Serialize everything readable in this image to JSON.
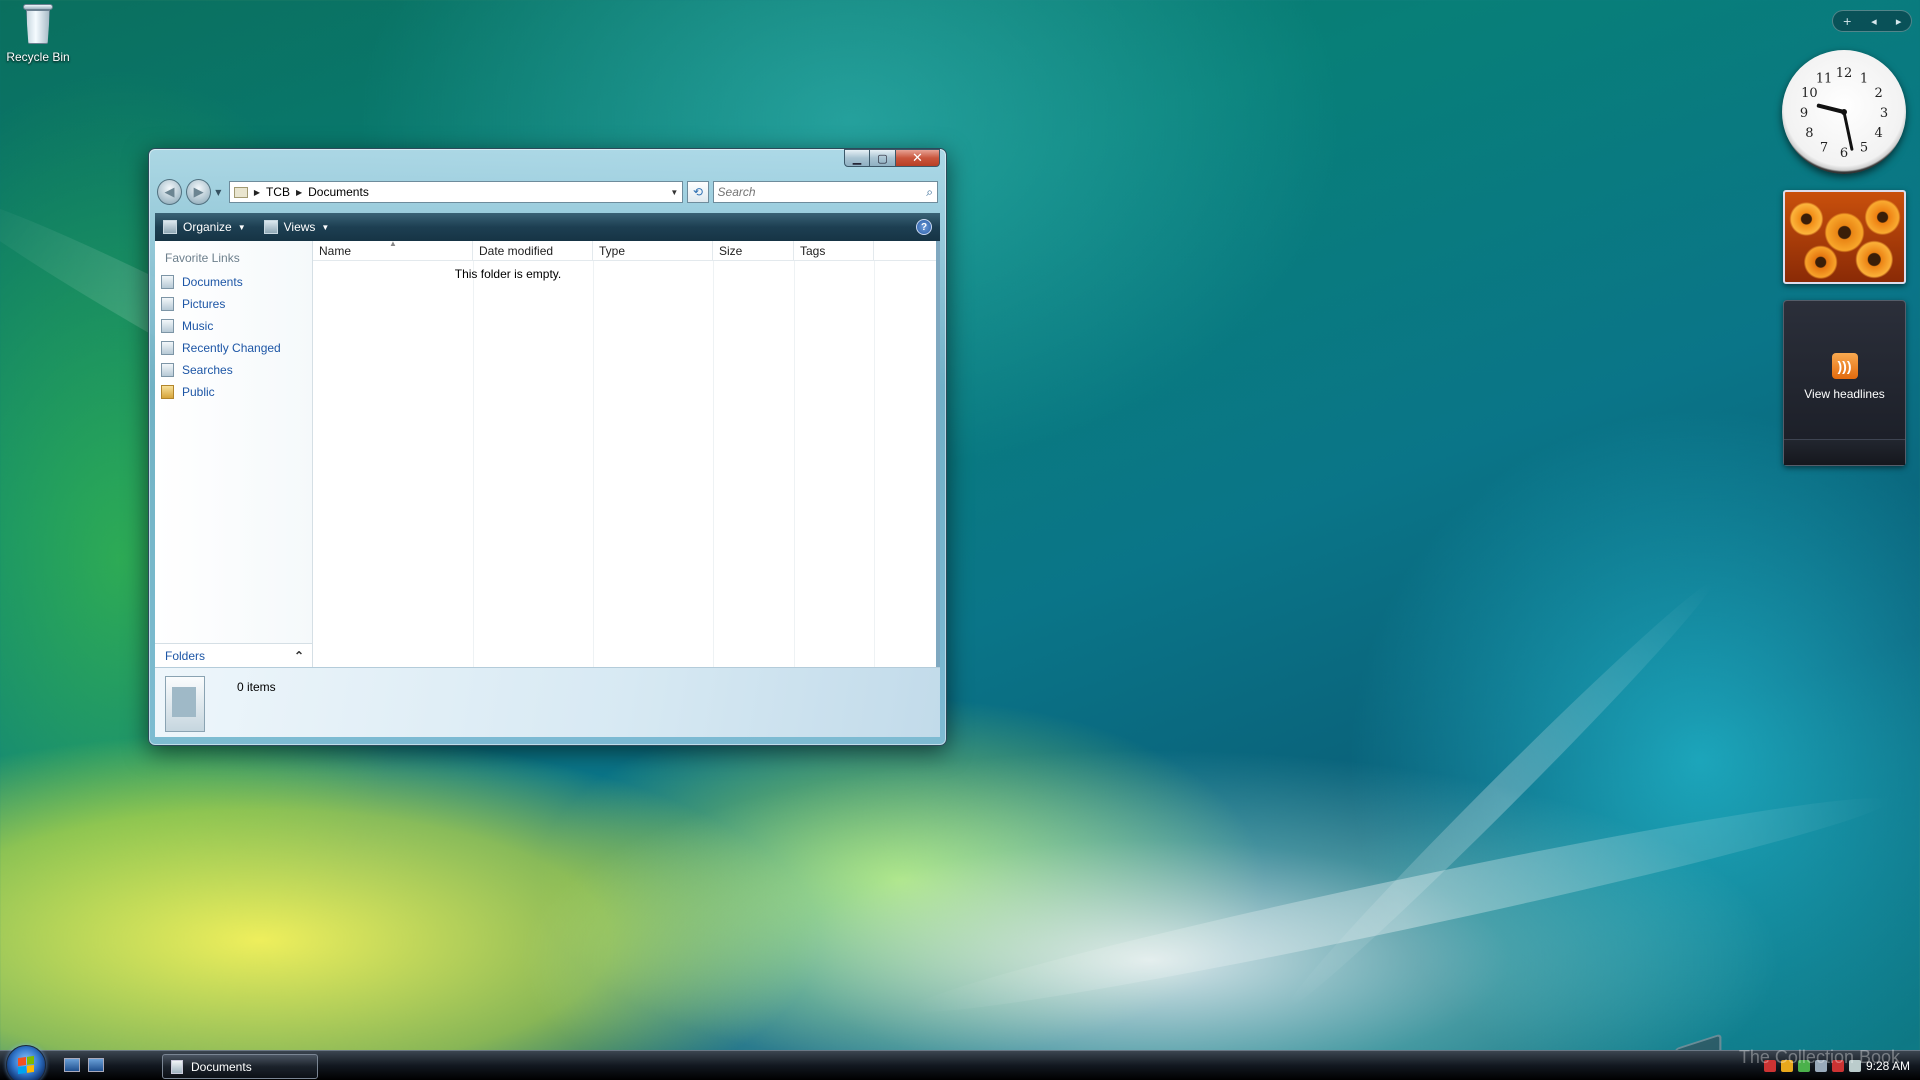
{
  "desktop": {
    "icons": [
      {
        "label": "Recycle Bin",
        "icon": "recycle-bin-icon"
      }
    ]
  },
  "window": {
    "title": "Documents",
    "address": {
      "segments": [
        "TCB",
        "Documents"
      ]
    },
    "search": {
      "placeholder": "Search"
    },
    "toolbar": {
      "organize_label": "Organize",
      "views_label": "Views",
      "help_icon": "help-icon"
    },
    "nav_pane": {
      "title": "Favorite Links",
      "links": [
        {
          "label": "Documents",
          "icon": "documents-icon"
        },
        {
          "label": "Pictures",
          "icon": "pictures-icon"
        },
        {
          "label": "Music",
          "icon": "music-icon"
        },
        {
          "label": "Recently Changed",
          "icon": "recently-changed-icon"
        },
        {
          "label": "Searches",
          "icon": "searches-icon"
        },
        {
          "label": "Public",
          "icon": "public-folder-icon"
        }
      ],
      "folders_label": "Folders"
    },
    "columns": [
      "Name",
      "Date modified",
      "Type",
      "Size",
      "Tags"
    ],
    "empty_message": "This folder is empty.",
    "details": {
      "item_count": "0 items"
    }
  },
  "gadgets": {
    "clock": {
      "hour": 9,
      "minute": 28,
      "numerals": [
        "12",
        "1",
        "2",
        "3",
        "4",
        "5",
        "6",
        "7",
        "8",
        "9",
        "10",
        "11"
      ]
    },
    "feed": {
      "label": "View headlines"
    }
  },
  "taskbar": {
    "task_button": "Documents",
    "clock": "9:28 AM"
  },
  "watermark": "The Collection Book",
  "colors": {
    "link": "#1d56a6",
    "toolbar_bg": "#1d3f52",
    "close_red": "#c9553c"
  }
}
